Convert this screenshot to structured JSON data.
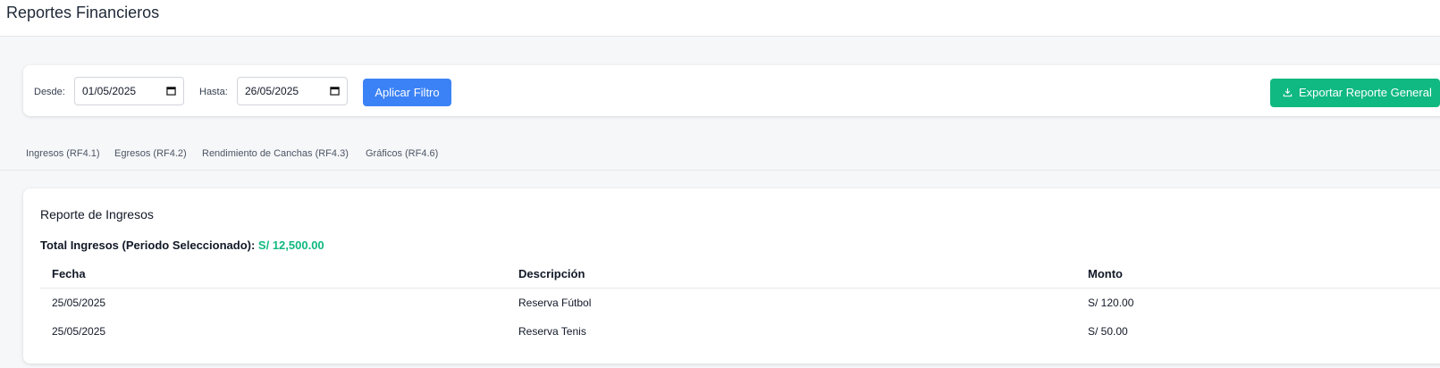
{
  "header": {
    "title": "Reportes Financieros"
  },
  "filters": {
    "from_label": "Desde:",
    "from_value": "01/05/2025",
    "to_label": "Hasta:",
    "to_value": "26/05/2025",
    "apply_label": "Aplicar Filtro",
    "export_label": "Exportar Reporte General"
  },
  "tabs": [
    {
      "label": "Ingresos (RF4.1)"
    },
    {
      "label": "Egresos (RF4.2)"
    },
    {
      "label": "Rendimiento de Canchas (RF4.3)"
    },
    {
      "label": "Gráficos (RF4.6)"
    }
  ],
  "report": {
    "title": "Reporte de Ingresos",
    "total_label": "Total Ingresos (Periodo Seleccionado):",
    "total_value": "S/ 12,500.00",
    "columns": [
      "Fecha",
      "Descripción",
      "Monto"
    ],
    "rows": [
      [
        "25/05/2025",
        "Reserva Fútbol",
        "S/ 120.00"
      ],
      [
        "25/05/2025",
        "Reserva Tenis",
        "S/ 50.00"
      ]
    ]
  },
  "colors": {
    "primary": "#3b82f6",
    "success": "#10b981"
  },
  "icons": {
    "calendar": "calendar-icon",
    "download": "download-icon"
  }
}
